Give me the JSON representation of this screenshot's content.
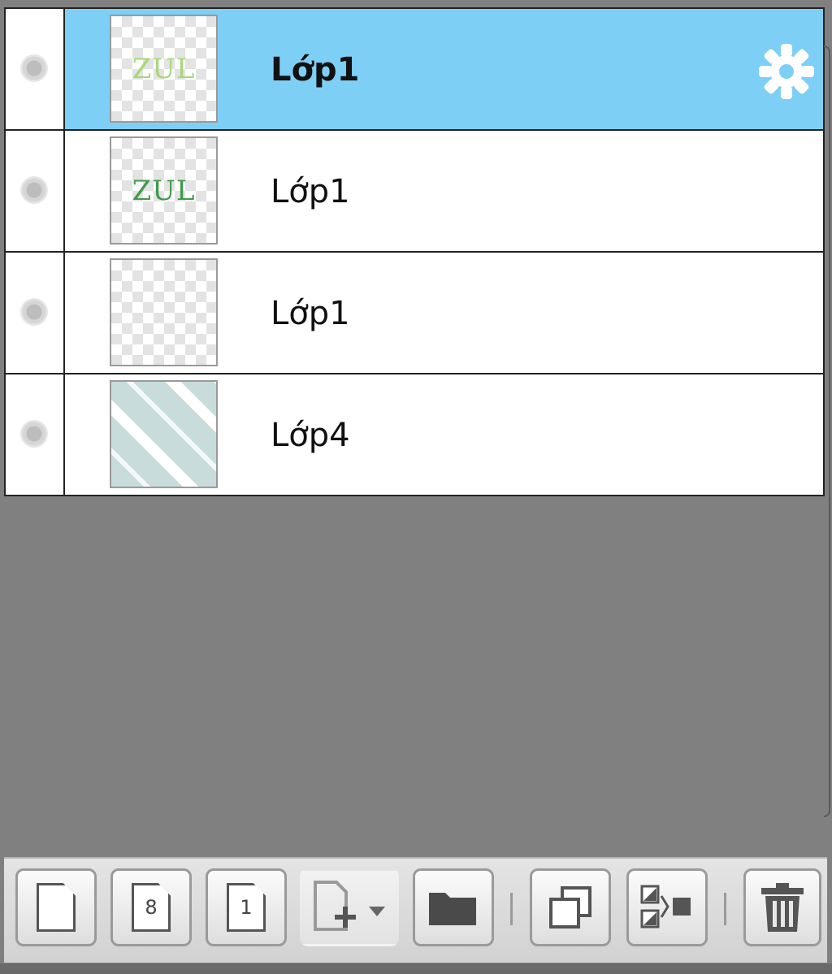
{
  "layers": [
    {
      "name": "Lớp1",
      "selected": true,
      "thumb_text": "ZUL",
      "thumb_color": "#a8d87a"
    },
    {
      "name": "Lớp1",
      "selected": false,
      "thumb_text": "ZUL",
      "thumb_color": "#3f9a4d"
    },
    {
      "name": "Lớp1",
      "selected": false,
      "thumb_text": "",
      "thumb_color": "#f0f0f0"
    },
    {
      "name": "Lớp4",
      "selected": false,
      "thumb_text": "",
      "thumb_color": "#c8dcdc"
    }
  ],
  "colors": {
    "selected_row": "#7ecff5",
    "panel_background": "#808080"
  },
  "icons": {
    "layer_settings": "gear-icon",
    "visibility": "visibility-dot-icon"
  },
  "toolbar": {
    "buttons": [
      {
        "name": "new-layer",
        "icon": "page-icon",
        "glyph": ""
      },
      {
        "name": "new-8bit-layer",
        "icon": "page-8-icon",
        "glyph": "8"
      },
      {
        "name": "new-1bit-layer",
        "icon": "page-1-icon",
        "glyph": "1"
      },
      {
        "name": "add-layer-menu",
        "icon": "page-plus-dropdown-icon",
        "glyph": ""
      },
      {
        "name": "new-folder",
        "icon": "folder-icon",
        "glyph": ""
      },
      {
        "name": "duplicate-layer",
        "icon": "duplicate-icon",
        "glyph": ""
      },
      {
        "name": "merge-layer",
        "icon": "merge-icon",
        "glyph": ""
      },
      {
        "name": "delete-layer",
        "icon": "trash-icon",
        "glyph": ""
      }
    ]
  }
}
